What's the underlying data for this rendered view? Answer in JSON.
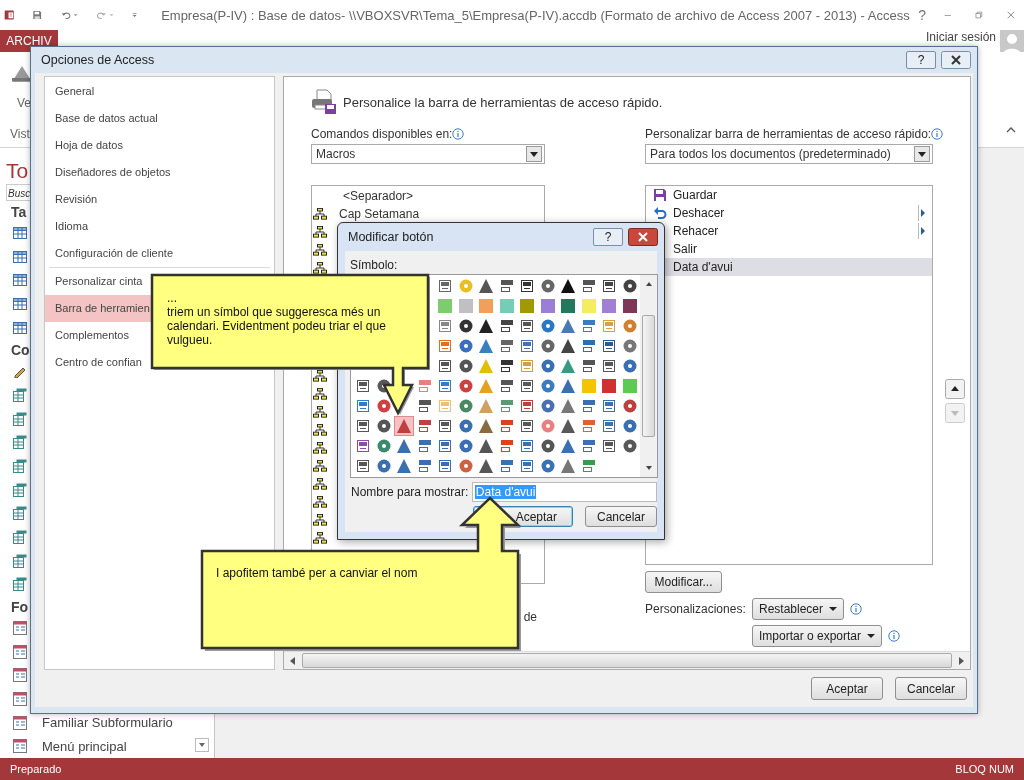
{
  "app": {
    "title": "Empresa(P-IV) : Base de datos- \\\\VBOXSVR\\Tema_5\\Empresa(P-IV).accdb (Formato de archivo de Access 2007 - 2013) - Access",
    "help": "?",
    "file_tab": "ARCHIV",
    "sign_in": "Iniciar sesión",
    "view_label": "Ve",
    "group_label": "Vist"
  },
  "nav_pane": {
    "title": "To",
    "search": "Busc",
    "groups": [
      {
        "title": "Ta",
        "items": [
          {
            "kind": "table"
          },
          {
            "kind": "table"
          },
          {
            "kind": "table"
          },
          {
            "kind": "table"
          },
          {
            "kind": "table"
          }
        ]
      },
      {
        "title": "Co",
        "items": [
          {
            "kind": "action-query"
          },
          {
            "kind": "query"
          },
          {
            "kind": "query"
          },
          {
            "kind": "query"
          },
          {
            "kind": "query"
          },
          {
            "kind": "query"
          },
          {
            "kind": "query"
          },
          {
            "kind": "query"
          },
          {
            "kind": "query"
          },
          {
            "kind": "query"
          }
        ]
      },
      {
        "title": "Fo",
        "items": [
          {
            "kind": "form"
          },
          {
            "kind": "form"
          },
          {
            "kind": "form"
          },
          {
            "kind": "form"
          },
          {
            "kind": "form",
            "label": "Familiar Subformulario"
          },
          {
            "kind": "form",
            "label": "Menú principal"
          }
        ]
      }
    ]
  },
  "options_dialog": {
    "title": "Opciones de Access",
    "help": "?",
    "category_groups": [
      [
        {
          "label": "General",
          "selected": false
        },
        {
          "label": "Base de datos actual",
          "selected": false
        },
        {
          "label": "Hoja de datos",
          "selected": false
        },
        {
          "label": "Diseñadores de objetos",
          "selected": false
        },
        {
          "label": "Revisión",
          "selected": false
        },
        {
          "label": "Idioma",
          "selected": false
        },
        {
          "label": "Configuración de cliente",
          "selected": false
        }
      ],
      [
        {
          "label": "Personalizar cinta",
          "selected": false
        },
        {
          "label": "Barra de herramien",
          "selected": true
        },
        {
          "label": "Complementos",
          "selected": false
        },
        {
          "label": "Centro de confian",
          "selected": false
        }
      ]
    ],
    "page_title": "Personalice la barra de herramientas de acceso rápido.",
    "commands_label": "Comandos disponibles en:",
    "commands_value": "Macros",
    "target_label": "Personalizar barra de herramientas de acceso rápido:",
    "target_value": "Para todos los documentos (predeterminado)",
    "commands": [
      {
        "kind": "separator",
        "label": "<Separador>"
      },
      {
        "kind": "macro",
        "label": "Cap Setamana"
      },
      {
        "kind": "macro"
      },
      {
        "kind": "macro"
      },
      {
        "kind": "macro"
      },
      {
        "kind": "blank"
      },
      {
        "kind": "blank"
      },
      {
        "kind": "blank"
      },
      {
        "kind": "blank"
      },
      {
        "kind": "blank"
      },
      {
        "kind": "macro"
      },
      {
        "kind": "macro"
      },
      {
        "kind": "macro"
      },
      {
        "kind": "macro"
      },
      {
        "kind": "macro"
      },
      {
        "kind": "macro"
      },
      {
        "kind": "macro"
      },
      {
        "kind": "macro"
      },
      {
        "kind": "macro"
      },
      {
        "kind": "macro"
      }
    ],
    "commands_note": "de",
    "toolbar": [
      {
        "kind": "save",
        "label": "Guardar",
        "submenu": false,
        "selected": false
      },
      {
        "kind": "undo",
        "label": "Deshacer",
        "submenu": true,
        "selected": false
      },
      {
        "label": "Rehacer",
        "submenu": true,
        "selected": false
      },
      {
        "label": "Salir",
        "submenu": false,
        "selected": false
      },
      {
        "label": "Data d'avui",
        "submenu": false,
        "selected": true
      }
    ],
    "modify_button": "Modificar...",
    "customizations_label": "Personalizaciones:",
    "reset_button": "Restablecer",
    "import_button": "Importar o exportar",
    "ok": "Aceptar",
    "cancel": "Cancelar"
  },
  "modify_dialog": {
    "title": "Modificar botón",
    "help": "?",
    "symbol_label": "Símbolo:",
    "name_label": "Nombre para mostrar:",
    "name_value": "Data d'avui",
    "ok": "Aceptar",
    "cancel": "Cancelar",
    "rows": [
      {
        "symbols": [
          {
            "kind": "blank"
          },
          {
            "kind": "blank"
          },
          {
            "kind": "blank"
          },
          {
            "kind": "blank"
          },
          {
            "kind": "icon",
            "color": "#666666",
            "selected": false
          },
          {
            "kind": "icon",
            "color": "#e8c020",
            "selected": false
          },
          {
            "kind": "icon",
            "color": "#555555",
            "selected": false
          },
          {
            "kind": "icon",
            "color": "#555555",
            "selected": false
          },
          {
            "kind": "icon",
            "color": "#333333",
            "selected": false
          },
          {
            "kind": "icon",
            "color": "#666666",
            "selected": false
          },
          {
            "kind": "icon",
            "color": "#111111",
            "selected": false
          },
          {
            "kind": "icon",
            "color": "#555555",
            "selected": false
          },
          {
            "kind": "icon",
            "color": "#444444",
            "selected": false
          },
          {
            "kind": "icon",
            "color": "#444444",
            "selected": false
          }
        ]
      },
      {
        "symbols": [
          {
            "kind": "blank"
          },
          {
            "kind": "blank"
          },
          {
            "kind": "blank"
          },
          {
            "kind": "blank"
          },
          {
            "kind": "swatch",
            "color": "#7dcc6e",
            "selected": false
          },
          {
            "kind": "swatch",
            "color": "#bfbfc4",
            "selected": false
          },
          {
            "kind": "swatch",
            "color": "#f0a05a",
            "selected": false
          },
          {
            "kind": "swatch",
            "color": "#76cdb5",
            "selected": false
          },
          {
            "kind": "swatch",
            "color": "#a09a00",
            "selected": false
          },
          {
            "kind": "swatch",
            "color": "#9b7fd4",
            "selected": false
          },
          {
            "kind": "swatch",
            "color": "#217a5b",
            "selected": false
          },
          {
            "kind": "swatch",
            "color": "#f5ec60",
            "selected": false
          },
          {
            "kind": "swatch",
            "color": "#a07fd4",
            "selected": false
          },
          {
            "kind": "swatch",
            "color": "#7e3757",
            "selected": false
          }
        ]
      },
      {
        "symbols": [
          {
            "kind": "blank"
          },
          {
            "kind": "blank"
          },
          {
            "kind": "blank"
          },
          {
            "kind": "blank"
          },
          {
            "kind": "icon",
            "color": "#888888",
            "selected": false
          },
          {
            "kind": "icon",
            "color": "#333333",
            "selected": false
          },
          {
            "kind": "icon",
            "color": "#222222",
            "selected": false
          },
          {
            "kind": "icon",
            "color": "#444444",
            "selected": false
          },
          {
            "kind": "icon",
            "color": "#555555",
            "selected": false
          },
          {
            "kind": "icon",
            "color": "#2b78c2",
            "selected": false
          },
          {
            "kind": "icon",
            "color": "#4a7ab5",
            "selected": false
          },
          {
            "kind": "icon",
            "color": "#3a7cc0",
            "selected": false
          },
          {
            "kind": "icon",
            "color": "#d9a040",
            "selected": false
          },
          {
            "kind": "icon",
            "color": "#d08030",
            "selected": false
          }
        ]
      },
      {
        "symbols": [
          {
            "kind": "blank"
          },
          {
            "kind": "blank"
          },
          {
            "kind": "blank"
          },
          {
            "kind": "blank"
          },
          {
            "kind": "icon",
            "color": "#e07020",
            "selected": false
          },
          {
            "kind": "icon",
            "color": "#3a6ec0",
            "selected": false
          },
          {
            "kind": "icon",
            "color": "#3a80c0",
            "selected": false
          },
          {
            "kind": "icon",
            "color": "#666666",
            "selected": false
          },
          {
            "kind": "icon",
            "color": "#4a70b0",
            "selected": false
          },
          {
            "kind": "icon",
            "color": "#666666",
            "selected": false
          },
          {
            "kind": "icon",
            "color": "#444444",
            "selected": false
          },
          {
            "kind": "icon",
            "color": "#2b70b0",
            "selected": false
          },
          {
            "kind": "icon",
            "color": "#2b5a90",
            "selected": false
          },
          {
            "kind": "icon",
            "color": "#777777",
            "selected": false
          }
        ]
      },
      {
        "symbols": [
          {
            "kind": "blank"
          },
          {
            "kind": "blank"
          },
          {
            "kind": "blank"
          },
          {
            "kind": "blank"
          },
          {
            "kind": "icon",
            "color": "#555555",
            "selected": false
          },
          {
            "kind": "icon",
            "color": "#555555",
            "selected": false
          },
          {
            "kind": "icon",
            "color": "#e0c000",
            "selected": false
          },
          {
            "kind": "icon",
            "color": "#333333",
            "selected": false
          },
          {
            "kind": "icon",
            "color": "#d0a040",
            "selected": false
          },
          {
            "kind": "icon",
            "color": "#3a70b0",
            "selected": false
          },
          {
            "kind": "icon",
            "color": "#3a9a80",
            "selected": false
          },
          {
            "kind": "icon",
            "color": "#555555",
            "selected": false
          },
          {
            "kind": "icon",
            "color": "#565656",
            "selected": false
          },
          {
            "kind": "icon",
            "color": "#3a70b1",
            "selected": false
          }
        ]
      },
      {
        "symbols": [
          {
            "kind": "icon",
            "color": "#555555",
            "selected": false
          },
          {
            "kind": "icon",
            "color": "#585858",
            "selected": false
          },
          {
            "kind": "blank"
          },
          {
            "kind": "icon",
            "color": "#e88080",
            "selected": false
          },
          {
            "kind": "icon",
            "color": "#3a7cc0",
            "selected": false
          },
          {
            "kind": "icon",
            "color": "#d04040",
            "selected": false
          },
          {
            "kind": "icon",
            "color": "#e8a020",
            "selected": false
          },
          {
            "kind": "icon",
            "color": "#555555",
            "selected": false
          },
          {
            "kind": "icon",
            "color": "#595959",
            "selected": false
          },
          {
            "kind": "icon",
            "color": "#3a7cc1",
            "selected": false
          },
          {
            "kind": "icon",
            "color": "#3a70b0",
            "selected": false
          },
          {
            "kind": "swatch",
            "color": "#f5c400",
            "selected": false
          },
          {
            "kind": "swatch",
            "color": "#d03030",
            "selected": false
          },
          {
            "kind": "swatch",
            "color": "#5ccc50",
            "selected": false
          }
        ]
      },
      {
        "symbols": [
          {
            "kind": "icon",
            "color": "#2b7cd0",
            "selected": false
          },
          {
            "kind": "icon",
            "color": "#d04040",
            "selected": false
          },
          {
            "kind": "blank"
          },
          {
            "kind": "icon",
            "color": "#555555",
            "selected": false
          },
          {
            "kind": "icon",
            "color": "#f0c070",
            "selected": false
          },
          {
            "kind": "icon",
            "color": "#4a8a60",
            "selected": false
          },
          {
            "kind": "icon",
            "color": "#d0a060",
            "selected": false
          },
          {
            "kind": "icon",
            "color": "#5a9a70",
            "selected": false
          },
          {
            "kind": "icon",
            "color": "#c04040",
            "selected": false
          },
          {
            "kind": "icon",
            "color": "#4a70b0",
            "selected": false
          },
          {
            "kind": "icon",
            "color": "#777778",
            "selected": false
          },
          {
            "kind": "icon",
            "color": "#3a70b0",
            "selected": false
          },
          {
            "kind": "icon",
            "color": "#3a70b2",
            "selected": false
          },
          {
            "kind": "icon",
            "color": "#c04041",
            "selected": false
          }
        ]
      },
      {
        "symbols": [
          {
            "kind": "icon",
            "color": "#555555",
            "selected": false
          },
          {
            "kind": "icon",
            "color": "#565656",
            "selected": false
          },
          {
            "kind": "icon",
            "color": "#c04040",
            "selected": true
          },
          {
            "kind": "icon",
            "color": "#c04042",
            "selected": false
          },
          {
            "kind": "icon",
            "color": "#575757",
            "selected": false
          },
          {
            "kind": "icon",
            "color": "#3a70b0",
            "selected": false
          },
          {
            "kind": "icon",
            "color": "#8a6a40",
            "selected": false
          },
          {
            "kind": "icon",
            "color": "#e04020",
            "selected": false
          },
          {
            "kind": "icon",
            "color": "#585858",
            "selected": false
          },
          {
            "kind": "icon",
            "color": "#e88080",
            "selected": false
          },
          {
            "kind": "icon",
            "color": "#595959",
            "selected": false
          },
          {
            "kind": "icon",
            "color": "#e06030",
            "selected": false
          },
          {
            "kind": "icon",
            "color": "#3a70b1",
            "selected": false
          },
          {
            "kind": "icon",
            "color": "#3a70b3",
            "selected": false
          }
        ]
      },
      {
        "symbols": [
          {
            "kind": "icon",
            "color": "#8a4ab0",
            "selected": false
          },
          {
            "kind": "icon",
            "color": "#3a8a70",
            "selected": false
          },
          {
            "kind": "icon",
            "color": "#3a70b0",
            "selected": false
          },
          {
            "kind": "icon",
            "color": "#3a70b1",
            "selected": false
          },
          {
            "kind": "icon",
            "color": "#3a70b2",
            "selected": false
          },
          {
            "kind": "icon",
            "color": "#3a70b3",
            "selected": false
          },
          {
            "kind": "icon",
            "color": "#555555",
            "selected": false
          },
          {
            "kind": "icon",
            "color": "#e04020",
            "selected": false
          },
          {
            "kind": "icon",
            "color": "#3a70b4",
            "selected": false
          },
          {
            "kind": "icon",
            "color": "#565656",
            "selected": false
          },
          {
            "kind": "icon",
            "color": "#3a70b5",
            "selected": false
          },
          {
            "kind": "icon",
            "color": "#3a70b6",
            "selected": false
          },
          {
            "kind": "icon",
            "color": "#575757",
            "selected": false
          },
          {
            "kind": "icon",
            "color": "#585858",
            "selected": false
          }
        ]
      },
      {
        "symbols": [
          {
            "kind": "icon",
            "color": "#555555",
            "selected": false
          },
          {
            "kind": "icon",
            "color": "#3a70b0",
            "selected": false
          },
          {
            "kind": "icon",
            "color": "#3a70b1",
            "selected": false
          },
          {
            "kind": "icon",
            "color": "#3a70b2",
            "selected": false
          },
          {
            "kind": "icon",
            "color": "#3a70b3",
            "selected": false
          },
          {
            "kind": "icon",
            "color": "#d06040",
            "selected": false
          },
          {
            "kind": "icon",
            "color": "#565656",
            "selected": false
          },
          {
            "kind": "icon",
            "color": "#3a70b4",
            "selected": false
          },
          {
            "kind": "icon",
            "color": "#3a70b5",
            "selected": false
          },
          {
            "kind": "icon",
            "color": "#3a70b6",
            "selected": false
          },
          {
            "kind": "icon",
            "color": "#777777",
            "selected": false
          },
          {
            "kind": "icon",
            "color": "#3a9a50",
            "selected": false
          }
        ]
      }
    ]
  },
  "callouts": [
    {
      "lines": [
        "...",
        "triem un símbol que suggeresca més un calendari. Evidentment podeu triar el que vulgueu."
      ]
    },
    {
      "lines": [
        "I apofitem també per a canviar el nom"
      ]
    }
  ],
  "status_bar": {
    "left": "Preparado",
    "right": "BLOQ NUM"
  }
}
